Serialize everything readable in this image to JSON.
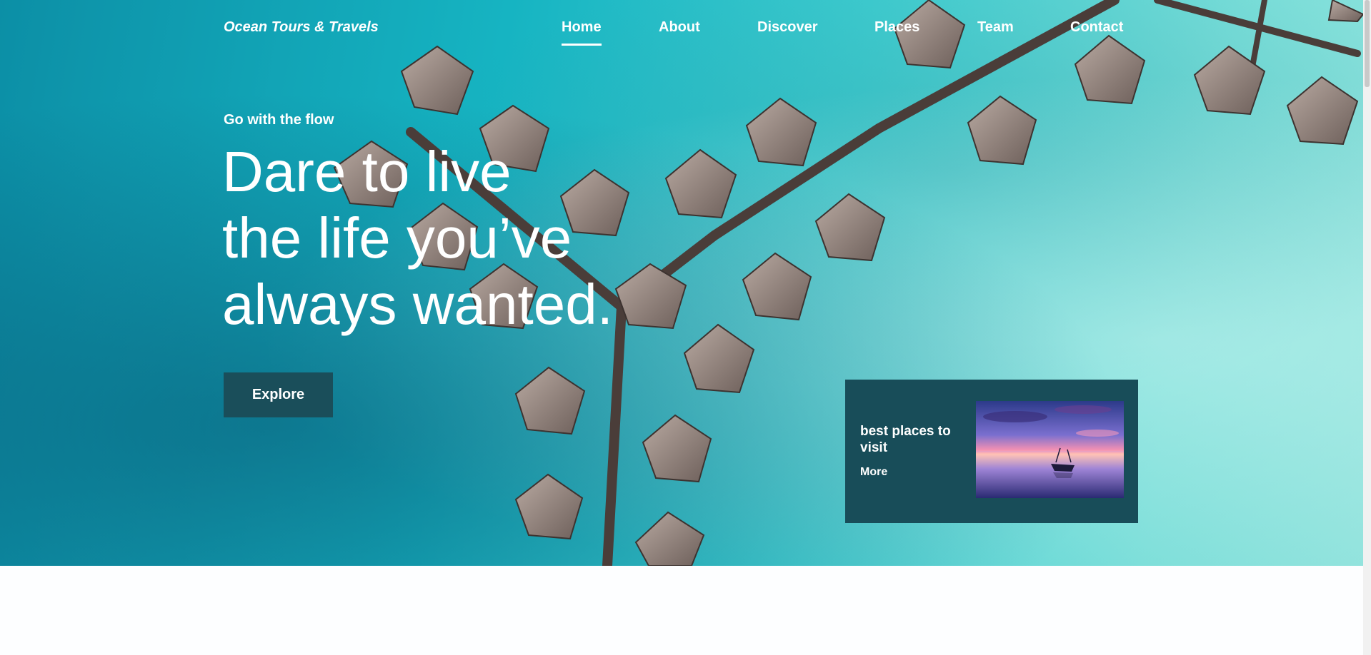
{
  "brand": {
    "name": "Ocean Tours & Travels"
  },
  "nav": {
    "items": [
      {
        "label": "Home",
        "active": true
      },
      {
        "label": "About",
        "active": false
      },
      {
        "label": "Discover",
        "active": false
      },
      {
        "label": "Places",
        "active": false
      },
      {
        "label": "Team",
        "active": false
      },
      {
        "label": "Contact",
        "active": false
      }
    ]
  },
  "hero": {
    "eyebrow": "Go with the flow",
    "headline": [
      "Dare to live",
      "the life you’ve",
      "always wanted."
    ],
    "cta_label": "Explore"
  },
  "card": {
    "title": "best places to visit",
    "more_label": "More"
  },
  "colors": {
    "dark_teal": "#184d59",
    "button": "#1a4e5a",
    "water": "#16b4c2",
    "text": "#ffffff"
  }
}
